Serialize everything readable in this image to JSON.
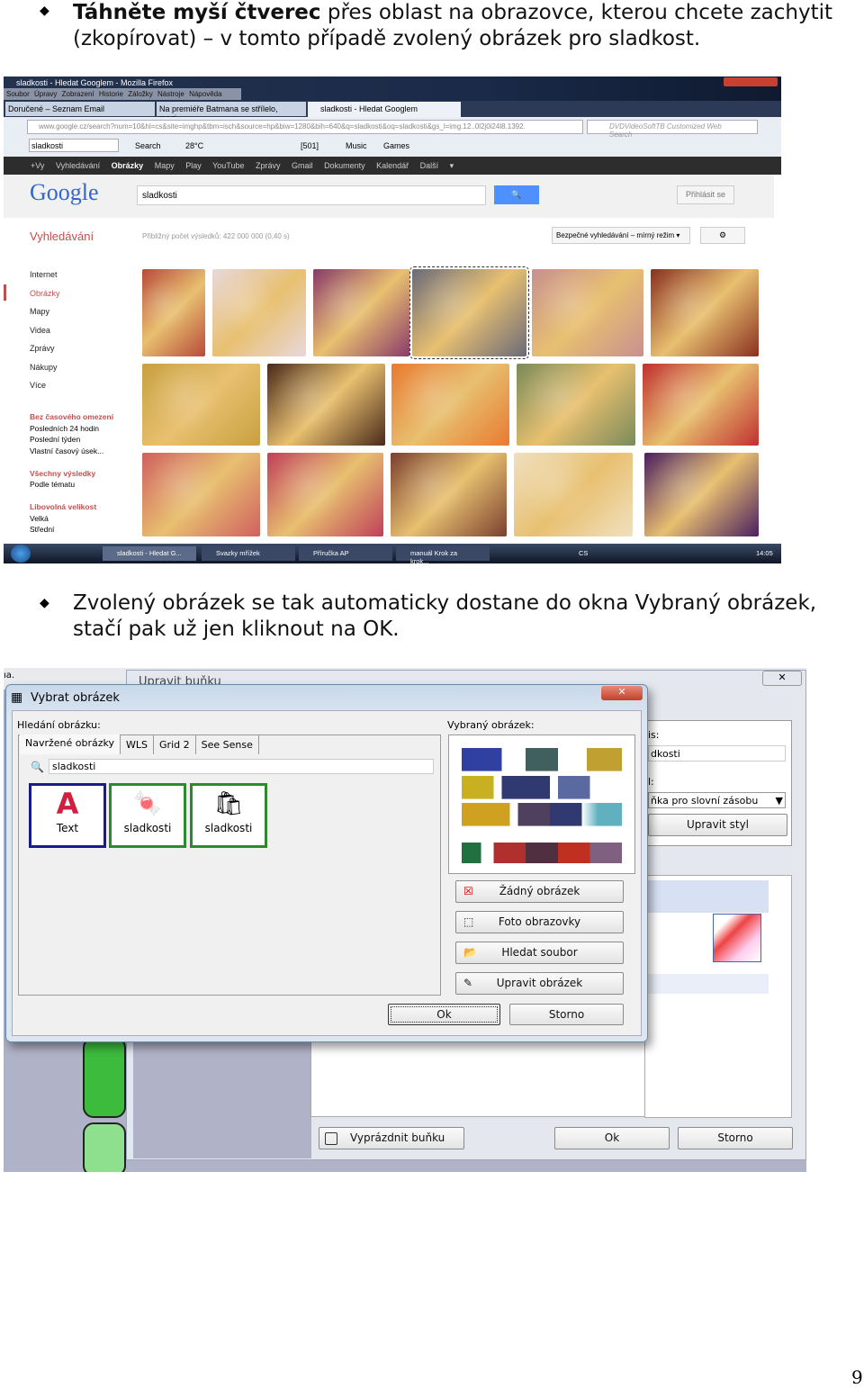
{
  "bullets": [
    {
      "bold": "Táhněte myší čtverec",
      "rest": " přes oblast na obrazovce, kterou chcete zachytit (zkopírovat) – v tomto případě zvolený obrázek pro sladkost."
    },
    {
      "text": "Zvolený obrázek se tak automaticky dostane do okna Vybraný obrázek, stačí pak už jen kliknout na OK."
    }
  ],
  "firefox": {
    "title": "sladkosti - Hledat Googlem - Mozilla Firefox",
    "menu": [
      "Soubor",
      "Úpravy",
      "Zobrazení",
      "Historie",
      "Záložky",
      "Nástroje",
      "Nápověda"
    ],
    "tabs": [
      "Doručené – Seznam Email",
      "Na premiéře Batmana se střílelo, mezi...",
      "sladkosti - Hledat Googlem"
    ],
    "url": "www.google.cz/search?num=10&hl=cs&site=imghp&tbm=isch&source=hp&biw=1280&bih=640&q=sladkosti&oq=sladkosti&gs_l=img.12..0l2j0i24l8.1392.",
    "search_placeholder": "DVDVideoSoftTB Customized Web Search",
    "toolbar": {
      "query": "sladkosti",
      "search": "Search",
      "temp": "28°C",
      "count": "[501]",
      "music": "Music",
      "games": "Games"
    },
    "google_bar": [
      "+Vy",
      "Vyhledávání",
      "Obrázky",
      "Mapy",
      "Play",
      "YouTube",
      "Zprávy",
      "Gmail",
      "Dokumenty",
      "Kalendář",
      "Další ▾"
    ],
    "google": {
      "logo": "Google",
      "query": "sladkosti",
      "signin": "Přihlásit se",
      "section": "Vyhledávání",
      "stats": "Přibližný počet výsledků: 422 000 000 (0,40 s)",
      "safe": "Bezpečné vyhledávání – mírný režim ▾"
    },
    "sidebar": [
      "Internet",
      "Obrázky",
      "Mapy",
      "Videa",
      "Zprávy",
      "Nákupy",
      "Více"
    ],
    "filters": [
      {
        "head": "Bez časového omezení",
        "items": [
          "Posledních 24 hodin",
          "Poslední týden",
          "Vlastní časový úsek..."
        ]
      },
      {
        "head": "Všechny výsledky",
        "items": [
          "Podle tématu"
        ]
      },
      {
        "head": "Libovolná velikost",
        "items": [
          "Velká",
          "Střední"
        ]
      }
    ],
    "thumb_colors": [
      "#b84a3a",
      "#e8d8dc",
      "#8a3a6a",
      "#6a6a7a",
      "#c89090",
      "#8a3020",
      "#c8a040",
      "#4a2a1a",
      "#e87a30",
      "#7a8a5a",
      "#c03030",
      "#d06060",
      "#c0405a",
      "#7a4030",
      "#f0e0c0",
      "#4a2060"
    ],
    "taskbar": [
      "sladkosti - Hledat G...",
      "Svazky mřížek",
      "Příručka AP",
      "manuál Krok za krok..."
    ],
    "clock": "14:05",
    "lang": "CS"
  },
  "dialog": {
    "bg_title": "Upravit buňku",
    "title": "Vybrat obrázek",
    "search_label": "Hledání obrázku:",
    "tabs": [
      "Navržené obrázky",
      "WLS",
      "Grid 2",
      "See Sense"
    ],
    "query": "sladkosti",
    "tiles": [
      "Text",
      "sladkosti",
      "sladkosti"
    ],
    "selected_label": "Vybraný obrázek:",
    "buttons": [
      "Žádný obrázek",
      "Foto obrazovky",
      "Hledat soubor",
      "Upravit obrázek"
    ],
    "ok": "Ok",
    "cancel": "Storno",
    "behind": {
      "label1": "is:",
      "value": "dkosti",
      "label2": "l:",
      "select": "ňka pro slovní zásobu",
      "style_btn": "Upravit styl",
      "clear": "Vyprázdnit buňku",
      "ok": "Ok",
      "cancel": "Storno",
      "corner": "ıа."
    }
  },
  "page_number": "9"
}
